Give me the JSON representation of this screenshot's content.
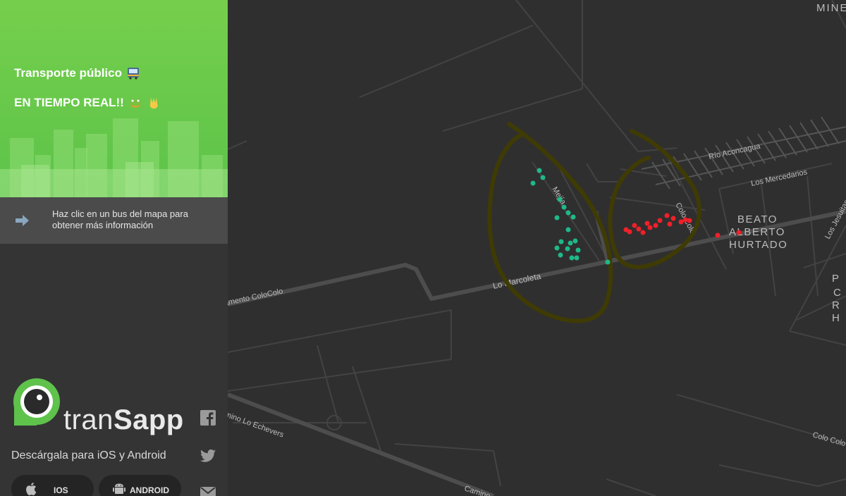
{
  "sidebar": {
    "title": "Transporte público",
    "subtitle": "EN TIEMPO REAL!!",
    "hint": "Haz clic en un bus del mapa para obtener más información",
    "brand_left": "tran",
    "brand_right": "Sapp",
    "download_text": "Descárgala para iOS y Android",
    "ios_label": "IOS",
    "android_label": "ANDROID",
    "icons": [
      "bus-emoji-icon",
      "frog-emoji-icon",
      "victory-hand-emoji-icon",
      "arrow-right-icon",
      "facebook-icon",
      "twitter-icon",
      "email-icon",
      "apple-icon",
      "android-icon"
    ]
  },
  "map": {
    "streets": {
      "mine": "MINE",
      "rio_aconcagua": "Río Aconcagua",
      "los_mercedarios": "Los Mercedarios",
      "beato1": "BEATO",
      "beato2": "ALBERTO",
      "beato3": "HURTADO",
      "colo_colo": "Colo Colo",
      "mejia": "Mejía",
      "lo_marcoleta": "Lo Marcoleta",
      "campamento": "Campamento ColoColo",
      "lo_echevers": "Camino Lo Echevers",
      "colo_colo_2": "Colo Colo",
      "los_jesuitas": "Los Jesuitas",
      "camino": "Camino",
      "edge_p": "P",
      "edge_c": "C",
      "edge_r": "R",
      "edge_h": "H"
    },
    "colors": {
      "background": "#2f2f2f",
      "road_major": "#4a4a4a",
      "road_minor": "#3f3f3f",
      "bus_green": "#1fb889",
      "bus_red": "#f0202a",
      "annotation": "#3f3b04"
    }
  }
}
